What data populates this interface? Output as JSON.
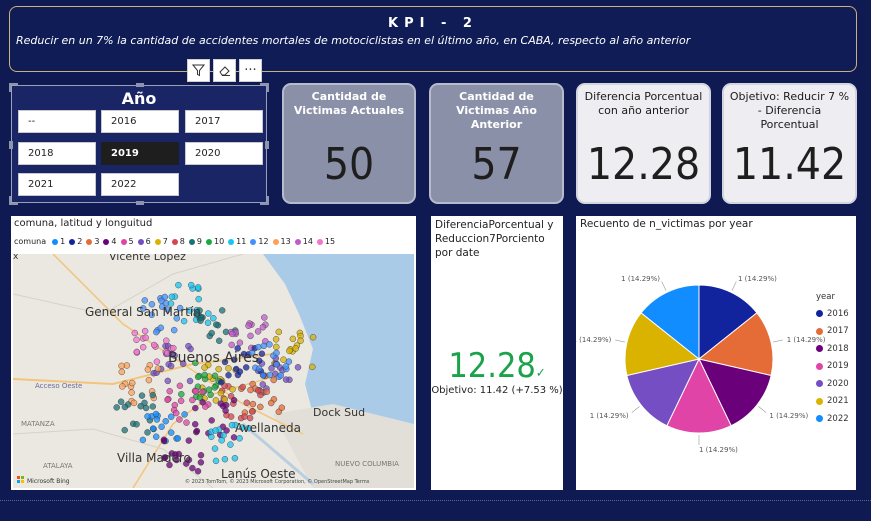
{
  "header": {
    "title": "KPI - 2",
    "subtitle": "Reducir en un 7% la cantidad de accidentes mortales de motociclistas en el último año, en CABA, respecto al año anterior"
  },
  "slicer": {
    "title": "Año",
    "options": [
      "--",
      "2016",
      "2017",
      "2018",
      "2019",
      "2020",
      "2021",
      "2022"
    ],
    "selected": "2019"
  },
  "toolbar": {
    "icons": [
      "filter-icon",
      "eraser-icon",
      "more-options-icon"
    ],
    "more_label": "···"
  },
  "cards": [
    {
      "label": "Cantidad de Victimas Actuales",
      "value": "50"
    },
    {
      "label": "Cantidad de Victimas Año Anterior",
      "value": "57"
    },
    {
      "label": "Diferencia Porcentual con año anterior",
      "value": "12.28"
    },
    {
      "label": "Objetivo: Reducir 7 % - Diferencia Porcentual",
      "value": "11.42"
    }
  ],
  "map": {
    "title": "comuna, latitud y longuitud",
    "legend_title": "comuna",
    "legend_items": [
      "1",
      "2",
      "3",
      "4",
      "5",
      "6",
      "7",
      "8",
      "9",
      "10",
      "11",
      "12",
      "13",
      "14",
      "15"
    ],
    "legend_colors": [
      "#118dff",
      "#12239e",
      "#e66c37",
      "#6b007b",
      "#e044a7",
      "#744ec2",
      "#d9b300",
      "#d64550",
      "#197278",
      "#1aab40",
      "#15c6f4",
      "#4092ff",
      "#ffa058",
      "#be5dc9",
      "#f472d0"
    ],
    "axis_x_label": "x",
    "places": [
      "Vicente López",
      "General San Martín",
      "Buenos Aires",
      "Dock Sud",
      "Avellaneda",
      "Villa Madero",
      "Lanús Oeste",
      "Acceso Oeste",
      "MATANZA",
      "ATALAYA",
      "NUEVO COLUMBIA"
    ],
    "provider": "Microsoft Bing",
    "attribution": "© 2023 TomTom, © 2023 Microsoft Corporation, © OpenStreetMap  Terms"
  },
  "kpi": {
    "title": "DiferenciaPorcentual y Reduccion7Porciento por date",
    "value": "12.28",
    "check": "✓",
    "goal": "Objetivo: 11.42 (+7.53 %)"
  },
  "pie": {
    "title": "Recuento de n_victimas por year",
    "legend_title": "year",
    "slice_label": "1 (14.29%)",
    "labels_pct": "(14.29%)",
    "labels_count": "1"
  },
  "chart_data": {
    "type": "pie",
    "title": "Recuento de n_victimas por year",
    "categories": [
      "2016",
      "2017",
      "2018",
      "2019",
      "2020",
      "2021",
      "2022"
    ],
    "values": [
      1,
      1,
      1,
      1,
      1,
      1,
      1
    ],
    "percentages": [
      14.29,
      14.29,
      14.29,
      14.29,
      14.29,
      14.29,
      14.29
    ],
    "colors": [
      "#12239e",
      "#e66c37",
      "#6b007b",
      "#e044a7",
      "#744ec2",
      "#d9b300",
      "#118dff"
    ],
    "legend_position": "right"
  }
}
